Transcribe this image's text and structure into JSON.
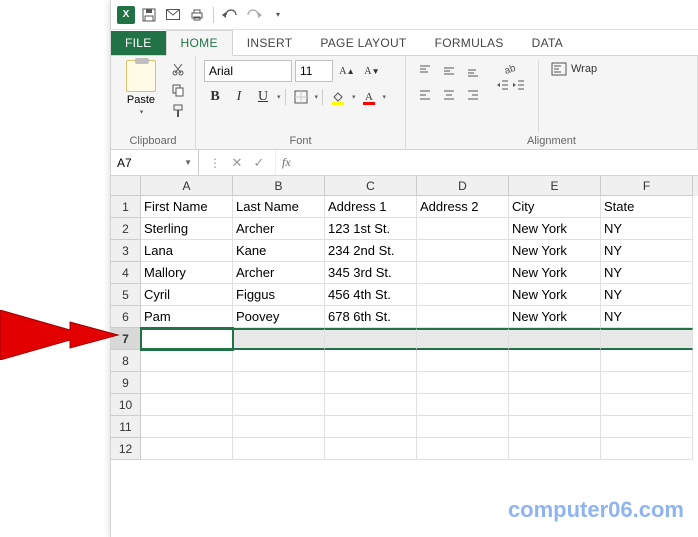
{
  "qat": {
    "app_short": "X"
  },
  "tabs": {
    "file": "FILE",
    "home": "HOME",
    "insert": "INSERT",
    "page_layout": "PAGE LAYOUT",
    "formulas": "FORMULAS",
    "data": "DATA"
  },
  "ribbon": {
    "clipboard": {
      "label": "Clipboard",
      "paste": "Paste"
    },
    "font": {
      "label": "Font",
      "name": "Arial",
      "size": "11",
      "bold": "B",
      "italic": "I",
      "underline": "U",
      "inc": "A",
      "dec": "A"
    },
    "alignment": {
      "label": "Alignment",
      "wrap": "Wrap"
    }
  },
  "namebox": "A7",
  "fx_label": "fx",
  "columns": [
    "A",
    "B",
    "C",
    "D",
    "E",
    "F"
  ],
  "row_labels": [
    "1",
    "2",
    "3",
    "4",
    "5",
    "6",
    "7",
    "8",
    "9",
    "10",
    "11",
    "12"
  ],
  "sheet": {
    "headers": [
      "First Name",
      "Last Name",
      "Address 1",
      "Address 2",
      "City",
      "State"
    ],
    "rows": [
      [
        "Sterling",
        "Archer",
        "123 1st St.",
        "",
        "New York",
        "NY"
      ],
      [
        "Lana",
        "Kane",
        "234 2nd St.",
        "",
        "New York",
        "NY"
      ],
      [
        "Mallory",
        "Archer",
        "345 3rd St.",
        "",
        "New York",
        "NY"
      ],
      [
        "Cyril",
        "Figgus",
        "456 4th St.",
        "",
        "New York",
        "NY"
      ],
      [
        "Pam",
        "Poovey",
        "678 6th St.",
        "",
        "New York",
        "NY"
      ]
    ]
  },
  "watermark": "computer06.com",
  "colors": {
    "excel_green": "#217346",
    "selection": "#e8e8e8"
  },
  "chart_data": {
    "type": "table",
    "title": "",
    "columns": [
      "First Name",
      "Last Name",
      "Address 1",
      "Address 2",
      "City",
      "State"
    ],
    "rows": [
      [
        "Sterling",
        "Archer",
        "123 1st St.",
        "",
        "New York",
        "NY"
      ],
      [
        "Lana",
        "Kane",
        "234 2nd St.",
        "",
        "New York",
        "NY"
      ],
      [
        "Mallory",
        "Archer",
        "345 3rd St.",
        "",
        "New York",
        "NY"
      ],
      [
        "Cyril",
        "Figgus",
        "456 4th St.",
        "",
        "New York",
        "NY"
      ],
      [
        "Pam",
        "Poovey",
        "678 6th St.",
        "",
        "New York",
        "NY"
      ]
    ]
  }
}
